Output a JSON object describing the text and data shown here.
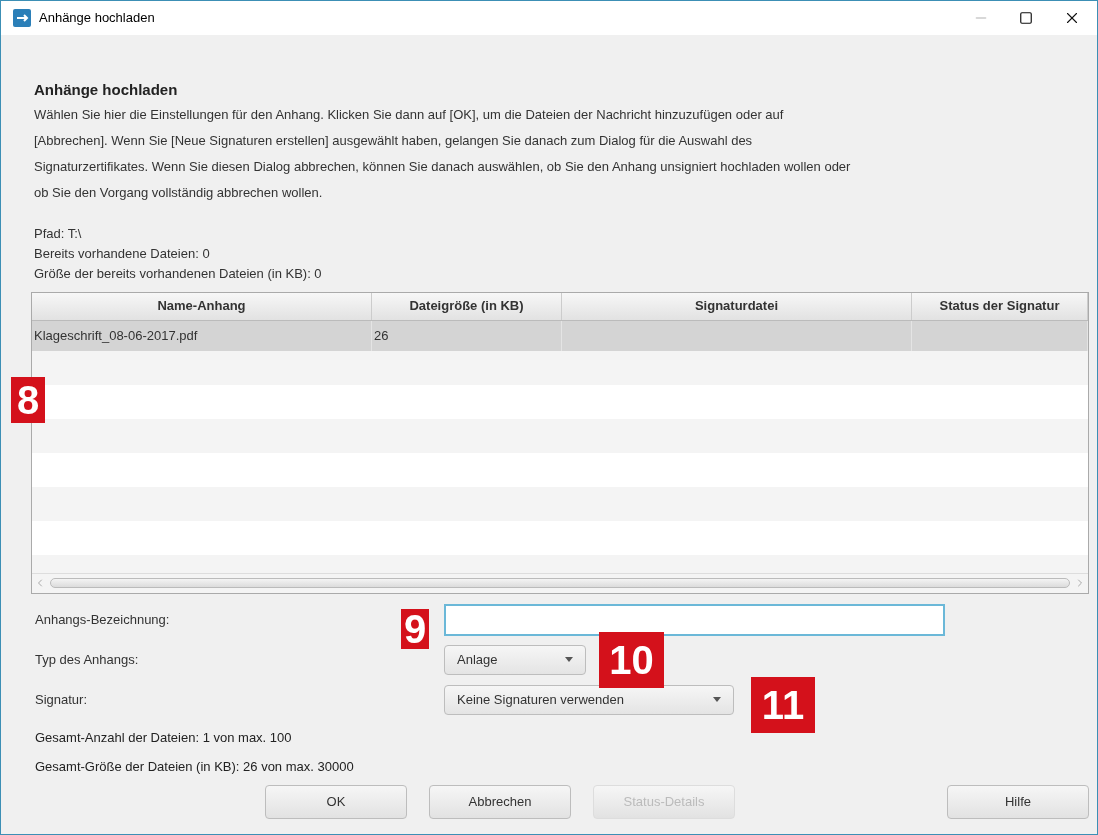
{
  "window": {
    "title": "Anhänge hochladen"
  },
  "heading": "Anhänge hochladen",
  "description": "Wählen Sie hier die Einstellungen für den Anhang. Klicken Sie dann auf [OK], um die Dateien der Nachricht hinzuzufügen oder auf\n[Abbrechen]. Wenn Sie [Neue Signaturen erstellen] ausgewählt haben, gelangen Sie danach zum Dialog für die Auswahl des\nSignaturzertifikates. Wenn Sie diesen Dialog abbrechen, können Sie danach auswählen, ob Sie den Anhang unsigniert hochladen wollen oder\nob Sie den Vorgang vollständig abbrechen wollen.",
  "info": [
    "Pfad: T:\\",
    "Bereits vorhandene Dateien: 0",
    "Größe der bereits vorhandenen Dateien (in KB): 0"
  ],
  "table": {
    "columns": [
      "Name-Anhang",
      "Dateigröße (in KB)",
      "Signaturdatei",
      "Status der Signatur"
    ],
    "rows": [
      {
        "cells": [
          "Klageschrift_08-06-2017.pdf",
          "26",
          "",
          ""
        ],
        "selected": true
      }
    ]
  },
  "form": [
    {
      "kind": "text",
      "label": "Anhangs-Bezeichnung:"
    },
    {
      "kind": "dropdown",
      "label": "Typ des Anhangs:",
      "value": "Anlage"
    },
    {
      "kind": "dropdown",
      "label": "Signatur:",
      "value": "Keine Signaturen verwenden"
    }
  ],
  "totals": [
    "Gesamt-Anzahl der Dateien: 1 von max. 100",
    "Gesamt-Größe der Dateien (in KB): 26 von max. 30000"
  ],
  "buttons": [
    {
      "label": "OK",
      "disabled": false
    },
    {
      "label": "Abbrechen",
      "disabled": false
    },
    {
      "label": "Status-Details",
      "disabled": true
    },
    {
      "label": "Hilfe",
      "disabled": false
    }
  ],
  "callouts": [
    "8",
    "9",
    "10",
    "11"
  ]
}
